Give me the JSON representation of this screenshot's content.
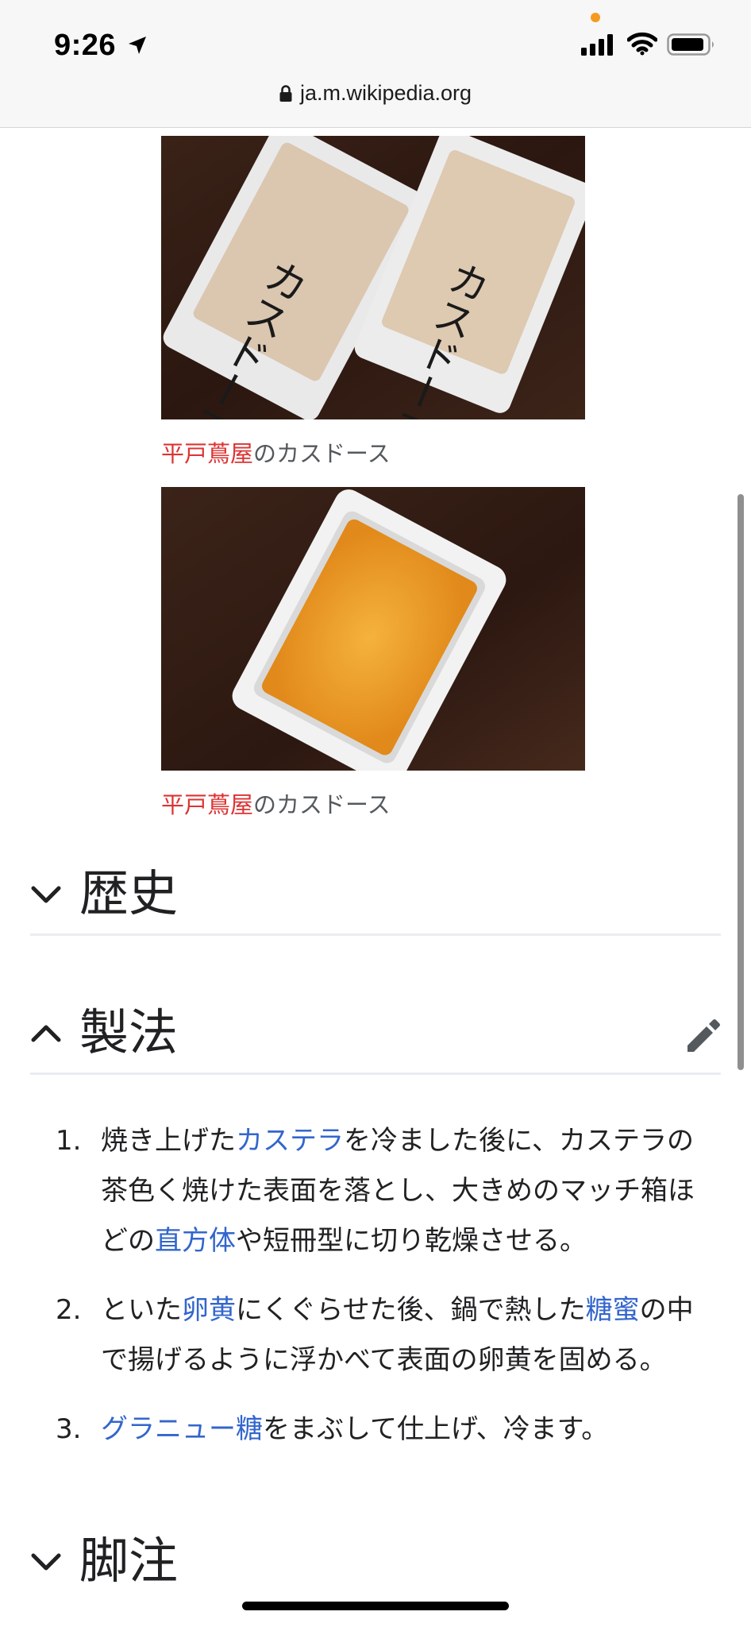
{
  "status": {
    "time": "9:26",
    "url": "ja.m.wikipedia.org"
  },
  "figures": [
    {
      "caption_link": "平戸蔦屋",
      "caption_rest": "のカスドース",
      "label_text": "カスドース"
    },
    {
      "caption_link": "平戸蔦屋",
      "caption_rest": "のカスドース"
    }
  ],
  "sections": {
    "history": "歴史",
    "method": "製法",
    "notes": "脚注"
  },
  "steps": [
    {
      "num": "1.",
      "parts": [
        "焼き上げた",
        "カステラ",
        "を冷ました後に、カステラの茶色く焼けた表面を落とし、大きめのマッチ箱ほどの",
        "直方体",
        "や短冊型に切り乾燥させる。"
      ]
    },
    {
      "num": "2.",
      "parts": [
        "といた",
        "卵黄",
        "にくぐらせた後、鍋で熱した",
        "糖蜜",
        "の中で揚げるように浮かべて表面の卵黄を固める。"
      ]
    },
    {
      "num": "3.",
      "parts": [
        "",
        "グラニュー糖",
        "をまぶして仕上げ、冷ます。"
      ]
    }
  ],
  "colors": {
    "link": "#3366cc",
    "redlink": "#dd3333",
    "text": "#202122",
    "divider": "#eaecf0"
  },
  "icons": [
    "location-arrow-icon",
    "signal-icon",
    "wifi-icon",
    "battery-icon",
    "lock-icon",
    "chevron-down-icon",
    "chevron-up-icon",
    "pencil-icon"
  ]
}
